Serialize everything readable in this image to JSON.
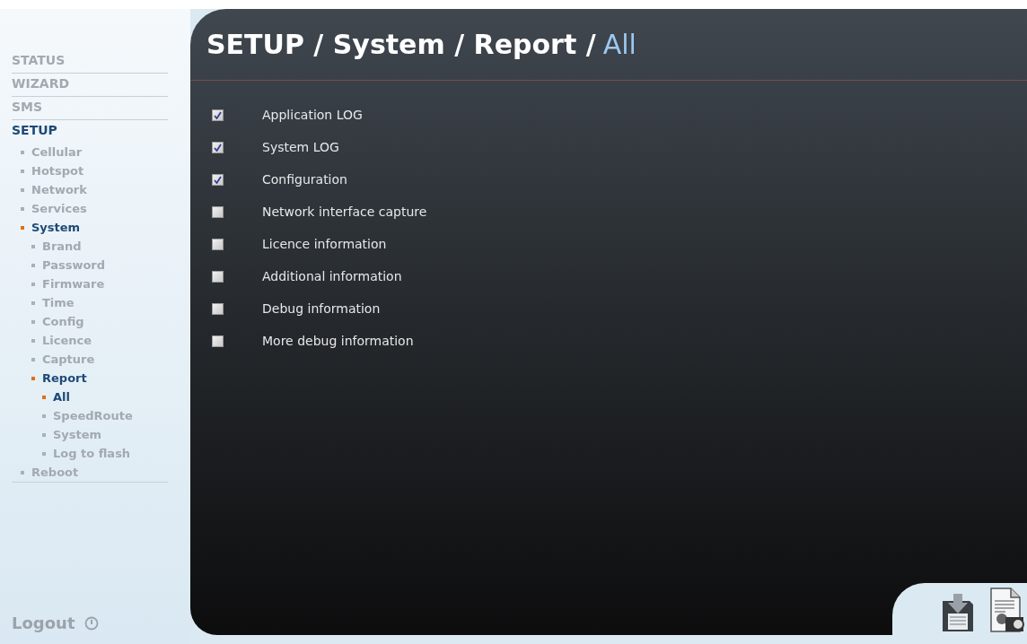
{
  "sidebar": {
    "items": [
      {
        "label": "STATUS",
        "selected": false
      },
      {
        "label": "WIZARD",
        "selected": false
      },
      {
        "label": "SMS",
        "selected": false
      },
      {
        "label": "SETUP",
        "selected": true,
        "children": [
          {
            "label": "Cellular",
            "selected": false
          },
          {
            "label": "Hotspot",
            "selected": false
          },
          {
            "label": "Network",
            "selected": false
          },
          {
            "label": "Services",
            "selected": false
          },
          {
            "label": "System",
            "selected": true,
            "children": [
              {
                "label": "Brand",
                "selected": false
              },
              {
                "label": "Password",
                "selected": false
              },
              {
                "label": "Firmware",
                "selected": false
              },
              {
                "label": "Time",
                "selected": false
              },
              {
                "label": "Config",
                "selected": false
              },
              {
                "label": "Licence",
                "selected": false
              },
              {
                "label": "Capture",
                "selected": false
              },
              {
                "label": "Report",
                "selected": true,
                "children": [
                  {
                    "label": "All",
                    "selected": true
                  },
                  {
                    "label": "SpeedRoute",
                    "selected": false
                  },
                  {
                    "label": "System",
                    "selected": false
                  },
                  {
                    "label": "Log to flash",
                    "selected": false
                  }
                ]
              }
            ]
          },
          {
            "label": "Reboot",
            "selected": false
          }
        ]
      }
    ],
    "logout": "Logout"
  },
  "title": [
    {
      "text": "SETUP / System / Report /",
      "current": false
    },
    {
      "text": "All",
      "current": true
    }
  ],
  "options": [
    {
      "label": "Application LOG",
      "checked": true
    },
    {
      "label": "System LOG",
      "checked": true
    },
    {
      "label": "Configuration",
      "checked": true
    },
    {
      "label": "Network interface capture",
      "checked": false
    },
    {
      "label": "Licence information",
      "checked": false
    },
    {
      "label": "Additional information",
      "checked": false
    },
    {
      "label": "Debug information",
      "checked": false
    },
    {
      "label": "More debug information",
      "checked": false
    }
  ]
}
